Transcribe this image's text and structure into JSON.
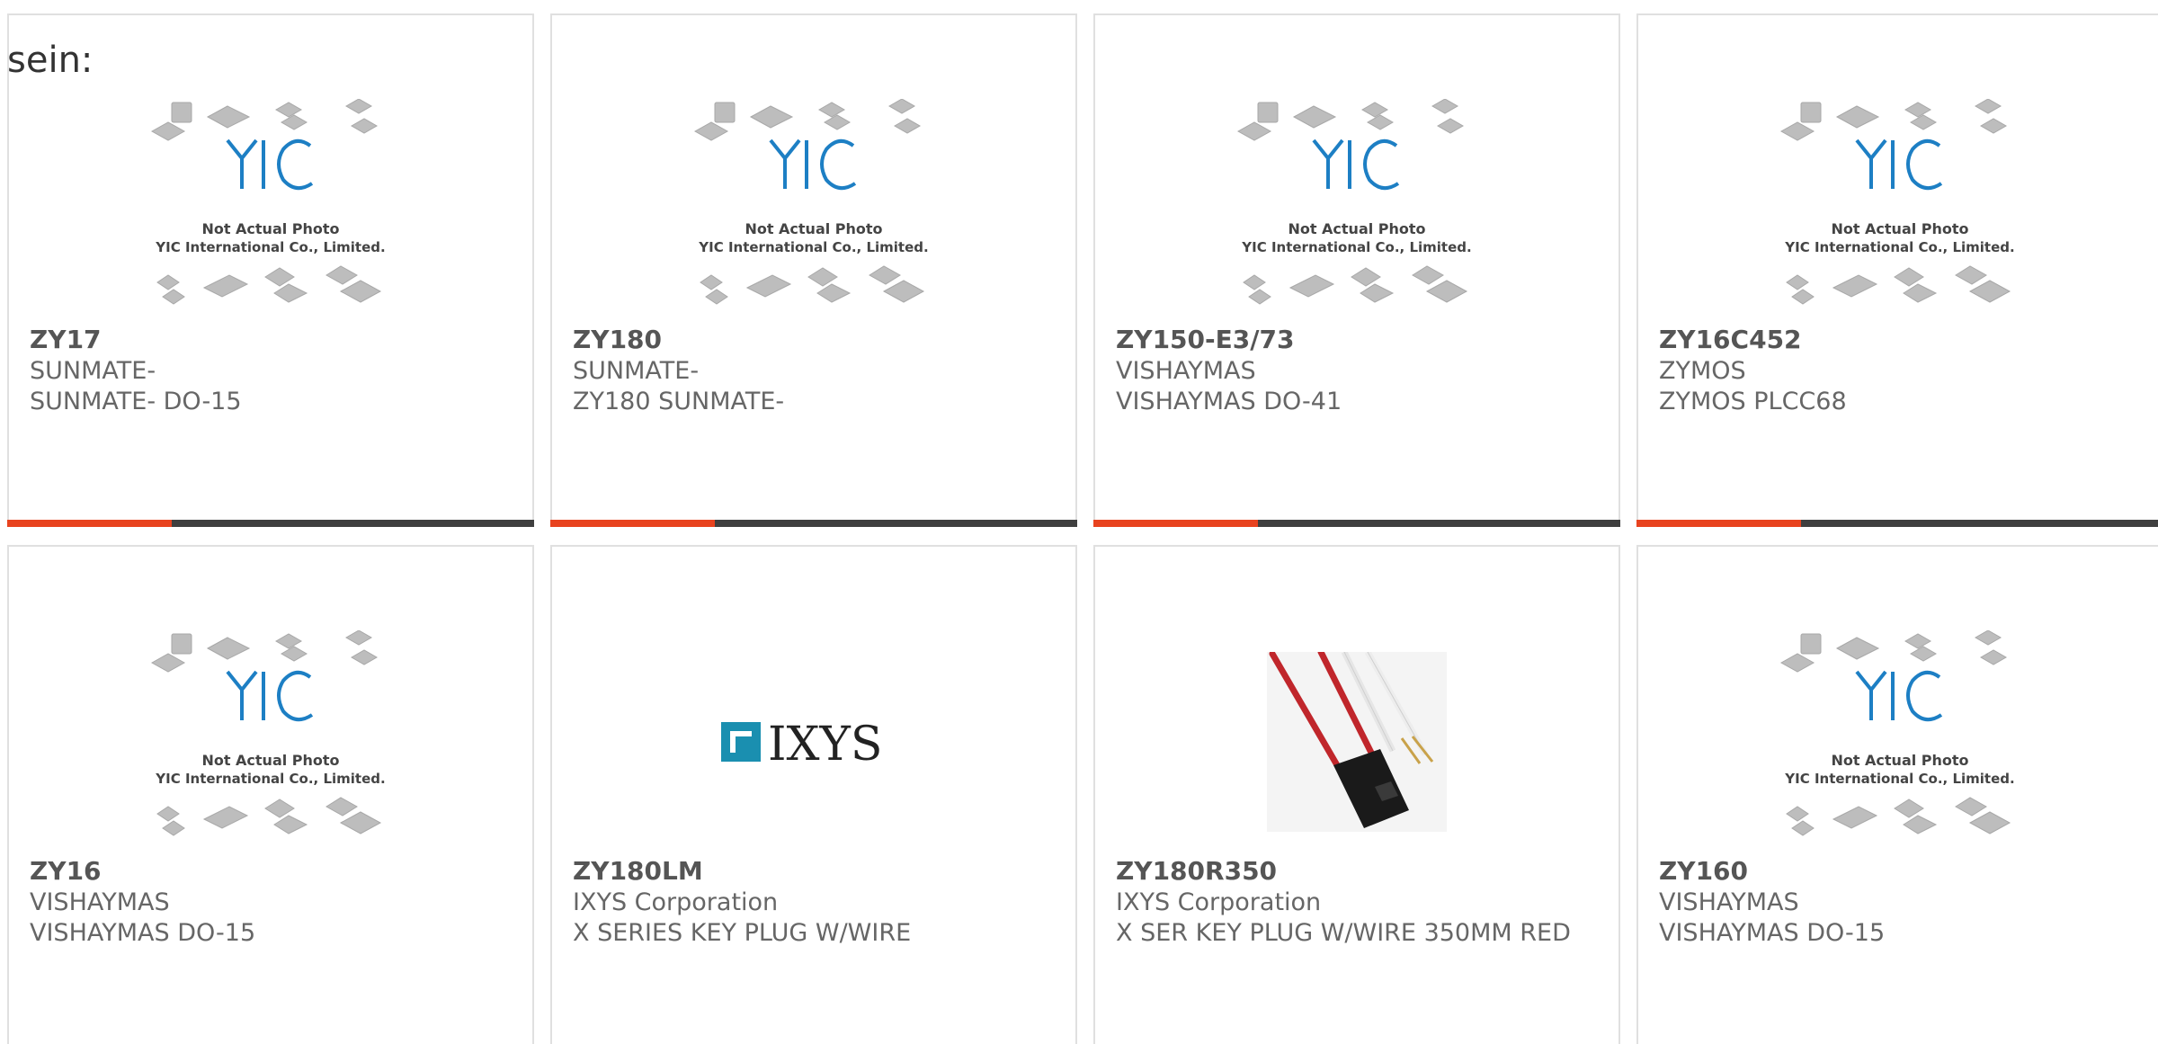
{
  "page": {
    "header_label": "sein:"
  },
  "colors": {
    "accent": "#e8431f",
    "bar": "#3f3f3f",
    "yic_blue": "#1d7fc4"
  },
  "placeholder": {
    "line1": "Not Actual Photo",
    "line2": "YIC International Co., Limited.",
    "logo_text": "YIC"
  },
  "products": [
    {
      "part": "ZY17",
      "maker": "SUNMATE-",
      "desc": "SUNMATE- DO-15",
      "image": "placeholder"
    },
    {
      "part": "ZY180",
      "maker": "SUNMATE-",
      "desc": "ZY180 SUNMATE-",
      "image": "placeholder"
    },
    {
      "part": "ZY150-E3/73",
      "maker": "VISHAYMAS",
      "desc": "VISHAYMAS DO-41",
      "image": "placeholder"
    },
    {
      "part": "ZY16C452",
      "maker": "ZYMOS",
      "desc": "ZYMOS PLCC68",
      "image": "placeholder"
    },
    {
      "part": "ZY16",
      "maker": "VISHAYMAS",
      "desc": "VISHAYMAS DO-15",
      "image": "placeholder"
    },
    {
      "part": "ZY180LM",
      "maker": "IXYS Corporation",
      "desc": "X SERIES KEY PLUG W/WIRE",
      "image": "ixys-logo",
      "logo_text": "IXYS"
    },
    {
      "part": "ZY180R350",
      "maker": "IXYS Corporation",
      "desc": "X SER KEY PLUG W/WIRE 350MM RED",
      "image": "connector-photo"
    },
    {
      "part": "ZY160",
      "maker": "VISHAYMAS",
      "desc": "VISHAYMAS DO-15",
      "image": "placeholder"
    }
  ]
}
